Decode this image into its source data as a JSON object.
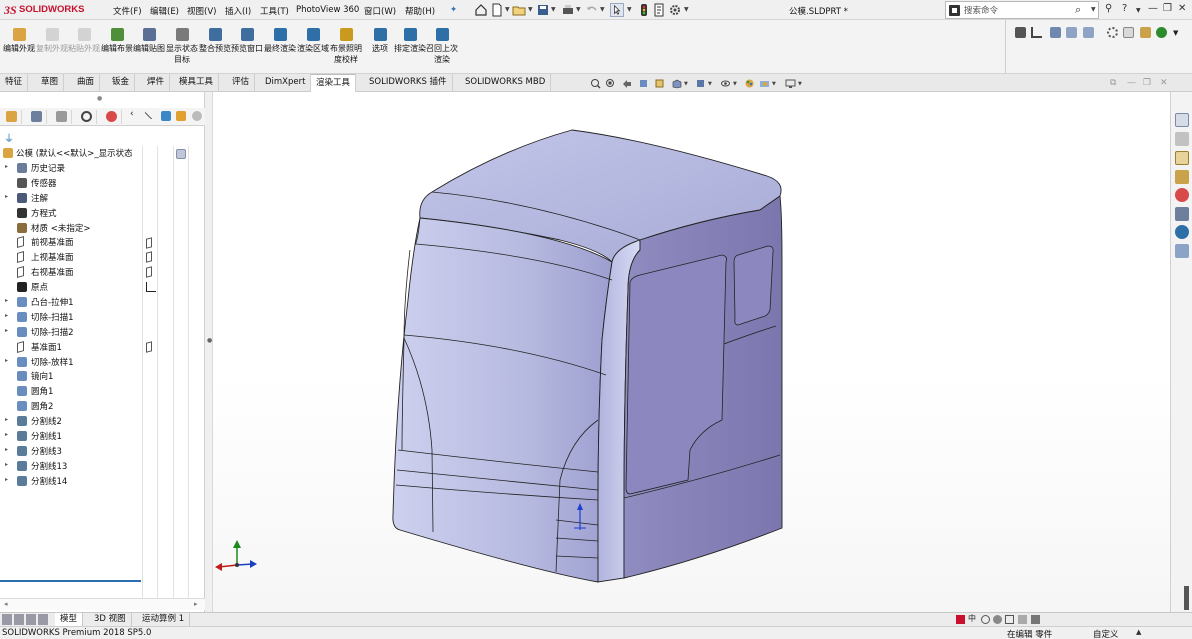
{
  "app": {
    "logo_mark": "3S",
    "logo_text": "SOLIDWORKS",
    "document_title": "公模.SLDPRT *"
  },
  "menu": [
    "文件(F)",
    "编辑(E)",
    "视图(V)",
    "插入(I)",
    "工具(T)",
    "PhotoView 360",
    "窗口(W)",
    "帮助(H)"
  ],
  "search": {
    "placeholder": "搜索命令"
  },
  "window_controls": {
    "help": "?",
    "minimize": "—",
    "restore": "❐",
    "close": "✕"
  },
  "ribbon": {
    "buttons": [
      {
        "label": "编辑外观",
        "icon": "edit-appearance-icon",
        "enabled": true,
        "color": "#d9a441"
      },
      {
        "label": "复制外观",
        "icon": "copy-appearance-icon",
        "enabled": false,
        "color": "#999999"
      },
      {
        "label": "粘贴外观",
        "icon": "paste-appearance-icon",
        "enabled": false,
        "color": "#999999"
      },
      {
        "label": "编辑布景",
        "icon": "edit-scene-icon",
        "enabled": true,
        "color": "#4f8f3a"
      },
      {
        "label": "编辑贴图",
        "icon": "edit-decal-icon",
        "enabled": true,
        "color": "#5b6f95"
      },
      {
        "label": "显示状态目标",
        "icon": "display-state-target-icon",
        "enabled": true,
        "color": "#7a7a7a"
      },
      {
        "label": "整合预览",
        "icon": "integrated-preview-icon",
        "enabled": true,
        "color": "#3f6e9e"
      },
      {
        "label": "预览窗口",
        "icon": "preview-window-icon",
        "enabled": true,
        "color": "#3f6e9e"
      },
      {
        "label": "最终渲染",
        "icon": "final-render-icon",
        "enabled": true,
        "color": "#2e6fa8"
      },
      {
        "label": "渲染区域",
        "icon": "render-region-icon",
        "enabled": true,
        "color": "#2e6fa8"
      },
      {
        "label": "布景照明度校样",
        "icon": "scene-illumination-proof-icon",
        "enabled": true,
        "color": "#c99a1e"
      },
      {
        "label": "选项",
        "icon": "options-icon",
        "enabled": true,
        "color": "#2e6fa8"
      },
      {
        "label": "排定渲染",
        "icon": "schedule-render-icon",
        "enabled": true,
        "color": "#2e6fa8"
      },
      {
        "label": "召回上次渲染",
        "icon": "recall-last-render-icon",
        "enabled": true,
        "color": "#2e6fa8"
      }
    ]
  },
  "command_tabs": [
    {
      "label": "特征",
      "active": false
    },
    {
      "label": "草图",
      "active": false
    },
    {
      "label": "曲面",
      "active": false
    },
    {
      "label": "钣金",
      "active": false
    },
    {
      "label": "焊件",
      "active": false
    },
    {
      "label": "模具工具",
      "active": false
    },
    {
      "label": "评估",
      "active": false
    },
    {
      "label": "DimXpert",
      "active": false
    },
    {
      "label": "渲染工具",
      "active": true
    },
    {
      "label": "SOLIDWORKS 插件",
      "active": false
    },
    {
      "label": "SOLIDWORKS MBD",
      "active": false
    }
  ],
  "feature_tree": {
    "root": "公模 (默认<<默认>_显示状态",
    "items": [
      {
        "label": "历史记录",
        "icon": "history-icon",
        "expandable": true
      },
      {
        "label": "传感器",
        "icon": "sensor-icon",
        "expandable": false
      },
      {
        "label": "注解",
        "icon": "annotation-icon",
        "expandable": true
      },
      {
        "label": "方程式",
        "icon": "equation-icon",
        "expandable": false
      },
      {
        "label": "材质 <未指定>",
        "icon": "material-icon",
        "expandable": false
      },
      {
        "label": "前视基准面",
        "icon": "plane-icon",
        "expandable": false
      },
      {
        "label": "上视基准面",
        "icon": "plane-icon",
        "expandable": false
      },
      {
        "label": "右视基准面",
        "icon": "plane-icon",
        "expandable": false
      },
      {
        "label": "原点",
        "icon": "origin-icon",
        "expandable": false
      },
      {
        "label": "凸台-拉伸1",
        "icon": "extrude-boss-icon",
        "expandable": true
      },
      {
        "label": "切除-扫描1",
        "icon": "cut-sweep-icon",
        "expandable": true
      },
      {
        "label": "切除-扫描2",
        "icon": "cut-sweep-icon",
        "expandable": true
      },
      {
        "label": "基准面1",
        "icon": "plane-icon",
        "expandable": false
      },
      {
        "label": "切除-放样1",
        "icon": "cut-loft-icon",
        "expandable": true
      },
      {
        "label": "镜向1",
        "icon": "mirror-icon",
        "expandable": false
      },
      {
        "label": "圆角1",
        "icon": "fillet-icon",
        "expandable": false
      },
      {
        "label": "圆角2",
        "icon": "fillet-icon",
        "expandable": false
      },
      {
        "label": "分割线2",
        "icon": "split-line-icon",
        "expandable": true
      },
      {
        "label": "分割线1",
        "icon": "split-line-icon",
        "expandable": true
      },
      {
        "label": "分割线3",
        "icon": "split-line-icon",
        "expandable": true
      },
      {
        "label": "分割线13",
        "icon": "split-line-icon",
        "expandable": true
      },
      {
        "label": "分割线14",
        "icon": "split-line-icon",
        "expandable": true
      }
    ]
  },
  "bottom_tabs": [
    {
      "label": "模型",
      "active": true
    },
    {
      "label": "3D 视图",
      "active": false
    },
    {
      "label": "运动算例 1",
      "active": false
    }
  ],
  "status_bar": {
    "product": "SOLIDWORKS Premium 2018 SP5.0",
    "editing": "在编辑 零件",
    "custom": "自定义"
  },
  "colors": {
    "accent": "#2a6fb0",
    "brand": "#c8102e",
    "model_face_light": "#b9bde2",
    "model_face_dark": "#8782b8"
  }
}
